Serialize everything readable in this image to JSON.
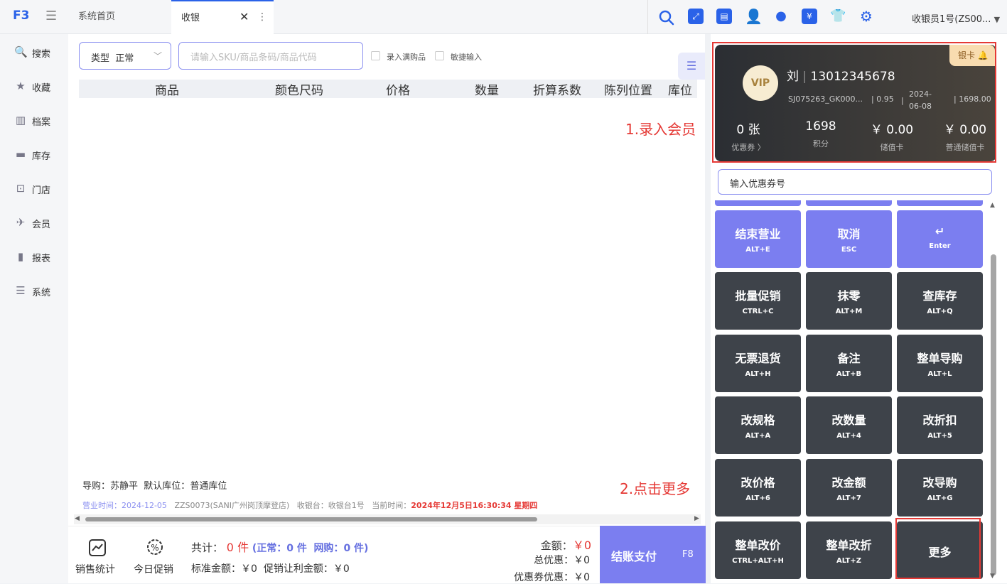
{
  "topbar": {
    "logo": "F3",
    "tabs": [
      {
        "label": "系统首页"
      },
      {
        "label": "收银"
      }
    ],
    "tab_close": "✕",
    "tab_menu": "⋮",
    "user": "收银员1号(ZS00...",
    "icon_colors": {
      "primary": "#2a62e8"
    }
  },
  "sidebar": {
    "items": [
      {
        "label": "搜索",
        "icon": "search-icon"
      },
      {
        "label": "收藏",
        "icon": "star-icon"
      },
      {
        "label": "档案",
        "icon": "archive-icon"
      },
      {
        "label": "库存",
        "icon": "inventory-icon"
      },
      {
        "label": "门店",
        "icon": "store-icon"
      },
      {
        "label": "会员",
        "icon": "member-icon"
      },
      {
        "label": "报表",
        "icon": "report-icon"
      },
      {
        "label": "系统",
        "icon": "system-icon"
      }
    ]
  },
  "toolbar": {
    "type_label": "类型",
    "type_value": "正常",
    "sku_placeholder": "请输入SKU/商品条码/商品代码",
    "check1": "录入满购品",
    "check2": "敏捷输入"
  },
  "table": {
    "headers": [
      "商品",
      "颜色尺码",
      "价格",
      "数量",
      "折算系数",
      "陈列位置",
      "库位"
    ]
  },
  "annotations": {
    "step1": "1.录入会员",
    "step2": "2.点击更多"
  },
  "footer_info": {
    "guide_label": "导购：",
    "guide_name": "苏静平",
    "default_loc_label": "默认库位：",
    "default_loc": "普通库位",
    "biz_time_label": "营业时间：",
    "biz_time": "2024-12-05",
    "store": "ZZS0073(SANI广州岗顶摩登店)",
    "register_label": "收银台：",
    "register": "收银台1号",
    "now_label": "当前时间：",
    "now": "2024年12月5日16:30:34 星期四"
  },
  "bottom": {
    "sales_stats": "销售统计",
    "today_promo": "今日促销",
    "total_label": "共计：",
    "total_count": "0 件",
    "normal_label": "(正常：",
    "normal_count": "0 件",
    "online_label": "网购：",
    "online_count": "0 件)",
    "std_amount": "标准金额：￥0",
    "promo_amount": "促销让利金额：￥0",
    "amount_label": "金额：",
    "amount": "￥0",
    "total_discount": "总优惠：￥0",
    "coupon_discount": "优惠券优惠：￥0",
    "pay_label": "结账支付",
    "pay_key": "F8"
  },
  "member_card": {
    "name": "刘",
    "phone": "13012345678",
    "vip": "VIP",
    "bind": "银卡",
    "code": "SJ075263_GK000...",
    "discount": "0.95",
    "date": "2024-06-08",
    "amount": "1698.00",
    "stats": [
      {
        "value": "0 张",
        "label": "优惠券 〉"
      },
      {
        "value": "1698",
        "label": "积分"
      },
      {
        "value": "￥ 0.00",
        "label": "储值卡"
      },
      {
        "value": "￥ 0.00",
        "label": "普通储值卡"
      }
    ]
  },
  "coupon_input": "输入优惠券号",
  "keys": [
    {
      "t": "结束营业",
      "s": "ALT+E",
      "style": "purple"
    },
    {
      "t": "取消",
      "s": "ESC",
      "style": "purple"
    },
    {
      "t": "↵",
      "s": "Enter",
      "style": "purple"
    },
    {
      "t": "批量促销",
      "s": "CTRL+C",
      "style": "dark"
    },
    {
      "t": "抹零",
      "s": "ALT+M",
      "style": "dark"
    },
    {
      "t": "查库存",
      "s": "ALT+Q",
      "style": "dark"
    },
    {
      "t": "无票退货",
      "s": "ALT+H",
      "style": "dark"
    },
    {
      "t": "备注",
      "s": "ALT+B",
      "style": "dark"
    },
    {
      "t": "整单导购",
      "s": "ALT+L",
      "style": "dark"
    },
    {
      "t": "改规格",
      "s": "ALT+A",
      "style": "dark"
    },
    {
      "t": "改数量",
      "s": "ALT+4",
      "style": "dark"
    },
    {
      "t": "改折扣",
      "s": "ALT+5",
      "style": "dark"
    },
    {
      "t": "改价格",
      "s": "ALT+6",
      "style": "dark"
    },
    {
      "t": "改金额",
      "s": "ALT+7",
      "style": "dark"
    },
    {
      "t": "改导购",
      "s": "ALT+G",
      "style": "dark"
    },
    {
      "t": "整单改价",
      "s": "CTRL+ALT+H",
      "style": "dark"
    },
    {
      "t": "整单改折",
      "s": "ALT+Z",
      "style": "dark"
    },
    {
      "t": "更多",
      "s": "",
      "style": "dark"
    }
  ]
}
